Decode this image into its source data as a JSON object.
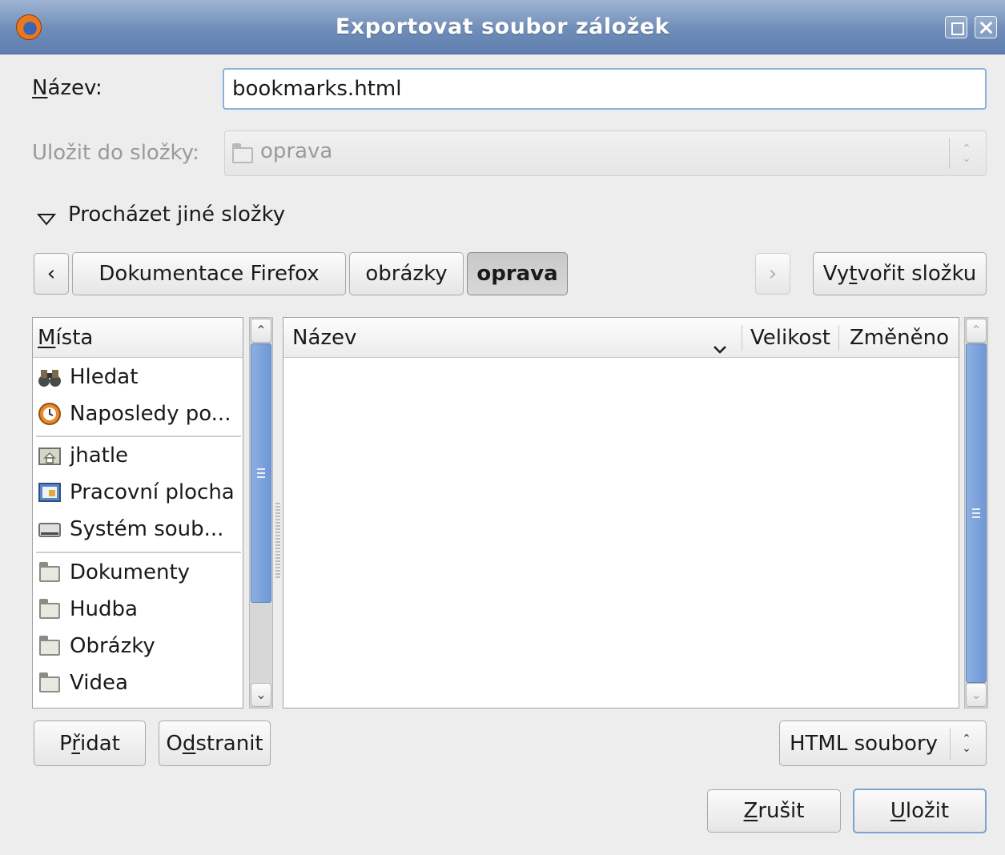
{
  "window": {
    "title": "Exportovat soubor záložek"
  },
  "form": {
    "name_label": "Název:",
    "name_value": "bookmarks.html",
    "folder_label": "Uložit do složky:",
    "folder_value": "oprava",
    "browse_label": "Procházet jiné složky"
  },
  "pathbar": {
    "back_label": "‹",
    "crumbs": [
      "Dokumentace Firefox",
      "obrázky",
      "oprava"
    ],
    "active_crumb": "oprava",
    "forward_label": "›",
    "create_folder_label": "Vytvořit složku"
  },
  "places": {
    "header": "Místa",
    "items": [
      {
        "label": "Hledat",
        "icon": "binoculars-icon"
      },
      {
        "label": "Naposledy po...",
        "icon": "recent-clock-icon"
      },
      {
        "label": "jhatle",
        "icon": "home-folder-icon"
      },
      {
        "label": "Pracovní plocha",
        "icon": "desktop-icon"
      },
      {
        "label": "Systém soub...",
        "icon": "drive-icon"
      },
      {
        "label": "Dokumenty",
        "icon": "folder-icon"
      },
      {
        "label": "Hudba",
        "icon": "folder-icon"
      },
      {
        "label": "Obrázky",
        "icon": "folder-icon"
      },
      {
        "label": "Videa",
        "icon": "folder-icon"
      }
    ],
    "add_label": "Přidat",
    "remove_label": "Odstranit"
  },
  "files": {
    "columns": [
      "Název",
      "Velikost",
      "Změněno"
    ],
    "rows": []
  },
  "filter": {
    "selected": "HTML soubory"
  },
  "actions": {
    "cancel_label": "Zrušit",
    "save_label": "Uložit"
  },
  "colors": {
    "titlebar": "#6f8db8",
    "scroll_thumb": "#7aa0d8",
    "focus_border": "#8cb0dc"
  }
}
